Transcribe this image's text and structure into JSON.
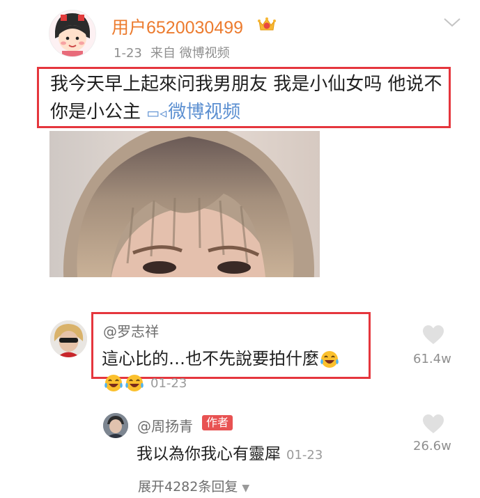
{
  "post": {
    "username": "用户6520030499",
    "date": "1-23",
    "source": "来自 微博视频",
    "text": "我今天早上起來问我男朋友 我是小仙女吗 他说不 你是小公主",
    "video_link_label": "微博视频",
    "icons": [
      "vip-crown-icon",
      "chevron-down-icon",
      "video-camera-icon"
    ]
  },
  "comments": [
    {
      "author": "@罗志祥",
      "text": "這心比的…也不先說要拍什麼",
      "date": "01-23",
      "likes": "61.4w",
      "emoji": "laugh-cry-emoji",
      "replies": [
        {
          "author": "@周扬青",
          "badge": "作者",
          "text": "我以為你我心有靈犀",
          "date": "01-23",
          "likes": "26.6w"
        }
      ]
    }
  ],
  "expand_replies": "展开4282条回复",
  "colors": {
    "username": "#ec7b2e",
    "link": "#5b8fd1",
    "highlight_border": "#e5363d",
    "author_badge": "#e85252"
  }
}
